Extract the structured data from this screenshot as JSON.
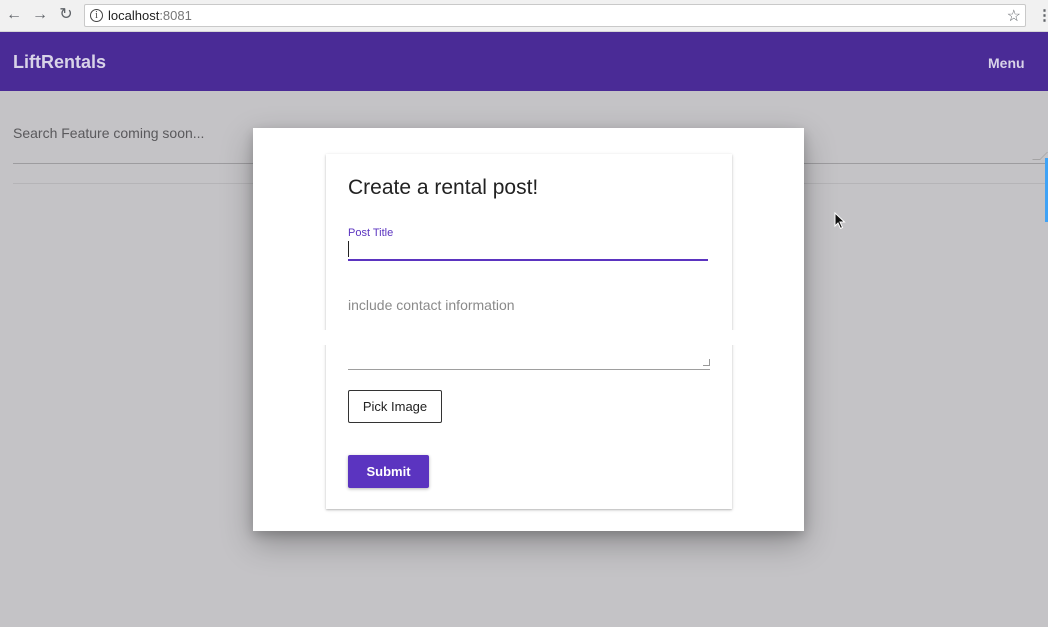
{
  "browser": {
    "url_host": "localhost",
    "url_port": ":8081",
    "back_icon": "arrow-left-icon",
    "forward_icon": "arrow-right-icon",
    "reload_icon": "reload-icon",
    "info_icon": "info-icon",
    "star_icon": "star-icon",
    "menu_icon": "kebab-icon"
  },
  "app_bar": {
    "brand": "LiftRentals",
    "menu_label": "Menu",
    "color": "#4a2b96"
  },
  "page": {
    "search_placeholder": "Search Feature coming soon..."
  },
  "modal": {
    "title": "Create a rental post!",
    "post_title_label": "Post Title",
    "post_title_value": "",
    "description_placeholder": "include contact information",
    "pick_image_label": "Pick Image",
    "submit_label": "Submit",
    "accent_color": "#5b34c0"
  }
}
